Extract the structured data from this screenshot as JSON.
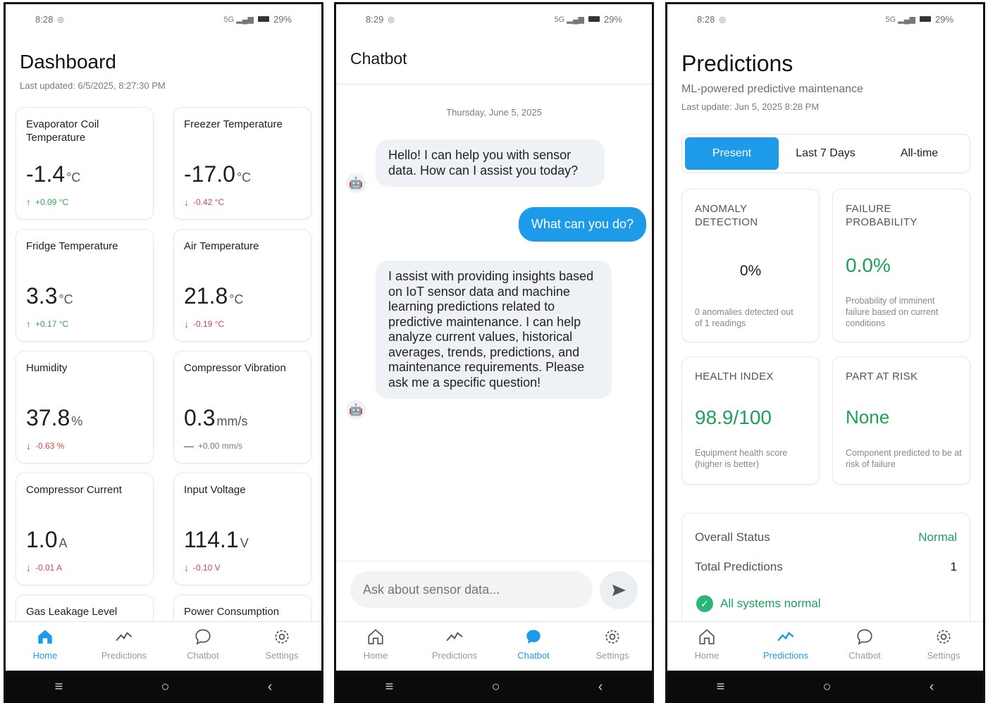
{
  "status_bars": [
    {
      "time": "8:28",
      "battery": "29%"
    },
    {
      "time": "8:29",
      "battery": "29%"
    },
    {
      "time": "8:28",
      "battery": "29%"
    }
  ],
  "nav": {
    "home": "Home",
    "predictions": "Predictions",
    "chatbot": "Chatbot",
    "settings": "Settings"
  },
  "dashboard": {
    "title": "Dashboard",
    "last_updated": "Last updated: 6/5/2025, 8:27:30 PM",
    "cards": [
      {
        "label": "Evaporator Coil Temperature",
        "value": "-1.4",
        "unit": "°C",
        "delta": "+0.09 °C",
        "trend": "up"
      },
      {
        "label": "Freezer Temperature",
        "value": "-17.0",
        "unit": "°C",
        "delta": "-0.42 °C",
        "trend": "down"
      },
      {
        "label": "Fridge Temperature",
        "value": "3.3",
        "unit": "°C",
        "delta": "+0.17 °C",
        "trend": "up"
      },
      {
        "label": "Air Temperature",
        "value": "21.8",
        "unit": "°C",
        "delta": "-0.19 °C",
        "trend": "down"
      },
      {
        "label": "Humidity",
        "value": "37.8",
        "unit": "%",
        "delta": "-0.63 %",
        "trend": "down"
      },
      {
        "label": "Compressor Vibration",
        "value": "0.3",
        "unit": "mm/s",
        "delta": "+0.00 mm/s",
        "trend": "flat"
      },
      {
        "label": "Compressor Current",
        "value": "1.0",
        "unit": "A",
        "delta": "-0.01 A",
        "trend": "down"
      },
      {
        "label": "Input Voltage",
        "value": "114.1",
        "unit": "V",
        "delta": "-0.10 V",
        "trend": "down"
      },
      {
        "label": "Gas Leakage Level",
        "value": "",
        "unit": "",
        "delta": "",
        "trend": ""
      },
      {
        "label": "Power Consumption",
        "value": "",
        "unit": "",
        "delta": "",
        "trend": ""
      }
    ]
  },
  "chatbot": {
    "title": "Chatbot",
    "date": "Thursday, June 5, 2025",
    "messages": [
      {
        "role": "bot",
        "text": "Hello! I can help you with sensor data. How can I assist you today?"
      },
      {
        "role": "user",
        "text": "What can you do?"
      },
      {
        "role": "bot",
        "text": "I assist with providing insights based on IoT sensor data and machine learning predictions related to predictive maintenance. I can help analyze current values, historical averages, trends, predictions, and maintenance requirements. Please ask me a specific question!"
      }
    ],
    "input_placeholder": "Ask about sensor data..."
  },
  "predictions": {
    "title": "Predictions",
    "subtitle": "ML-powered predictive maintenance",
    "last_update": "Last update: Jun 5, 2025 8:28 PM",
    "tabs": [
      "Present",
      "Last 7 Days",
      "All-time"
    ],
    "active_tab": 0,
    "cards": [
      {
        "label": "ANOMALY DETECTION",
        "value": "0%",
        "desc": "0 anomalies detected out of 1 readings"
      },
      {
        "label": "FAILURE PROBABILITY",
        "value": "0.0%",
        "desc": "Probability of imminent failure based on current conditions"
      },
      {
        "label": "HEALTH INDEX",
        "value": "98.9/100",
        "desc": "Equipment health score (higher is better)"
      },
      {
        "label": "PART AT RISK",
        "value": "None",
        "desc": "Component predicted to be at risk of failure"
      }
    ],
    "overall_status_label": "Overall Status",
    "overall_status_value": "Normal",
    "total_predictions_label": "Total Predictions",
    "total_predictions_value": "1",
    "ok_message": "All systems normal"
  },
  "colors": {
    "accent": "#1e9be8",
    "good": "#1ca15a",
    "up": "#2fa84f",
    "down": "#d04848"
  }
}
